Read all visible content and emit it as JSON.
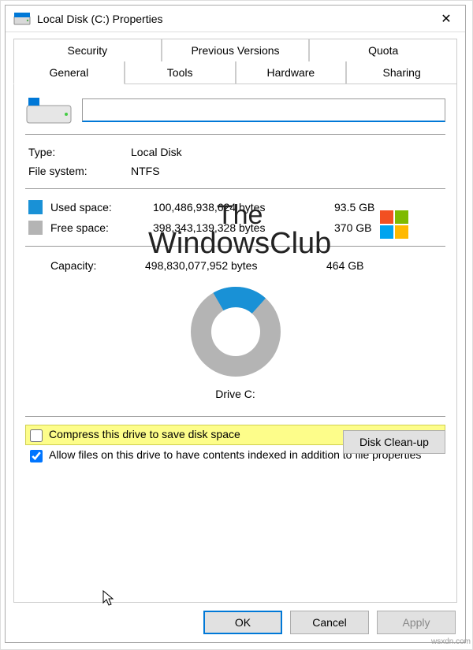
{
  "window": {
    "title": "Local Disk (C:) Properties",
    "close": "✕"
  },
  "tabs_row1": [
    "Security",
    "Previous Versions",
    "Quota"
  ],
  "tabs_row2": [
    "General",
    "Tools",
    "Hardware",
    "Sharing"
  ],
  "selected_tab": "General",
  "general": {
    "name_value": "",
    "type_label": "Type:",
    "type_value": "Local Disk",
    "fs_label": "File system:",
    "fs_value": "NTFS",
    "used_label": "Used space:",
    "used_bytes": "100,486,938,624 bytes",
    "used_gb": "93.5 GB",
    "used_color": "#1991d6",
    "free_label": "Free space:",
    "free_bytes": "398,343,139,328 bytes",
    "free_gb": "370 GB",
    "free_color": "#b4b4b4",
    "capacity_label": "Capacity:",
    "capacity_bytes": "498,830,077,952 bytes",
    "capacity_gb": "464 GB",
    "drive_label": "Drive C:",
    "cleanup_btn": "Disk Clean-up",
    "compress_label": "Compress this drive to save disk space",
    "compress_checked": false,
    "index_label": "Allow files on this drive to have contents indexed in addition to file properties",
    "index_checked": true
  },
  "chart_data": {
    "type": "pie",
    "title": "Drive C:",
    "series": [
      {
        "name": "Used space",
        "value": 100486938624,
        "value_gb": 93.5,
        "color": "#1991d6"
      },
      {
        "name": "Free space",
        "value": 398343139328,
        "value_gb": 370,
        "color": "#b4b4b4"
      }
    ]
  },
  "buttons": {
    "ok": "OK",
    "cancel": "Cancel",
    "apply": "Apply"
  },
  "watermark": {
    "line1": "The",
    "line2": "WindowsClub"
  },
  "side": "wsxdn.com"
}
